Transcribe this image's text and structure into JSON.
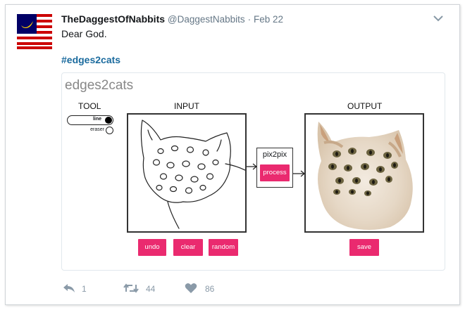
{
  "tweet": {
    "display_name": "TheDaggestOfNabbits",
    "handle": "@DaggestNabbits",
    "separator": "·",
    "date": "Feb 22",
    "text": "Dear God.",
    "hashtag": "#edges2cats",
    "avatar_icon": "flag-with-banana-icon"
  },
  "card": {
    "title": "edges2cats",
    "tool_label": "TOOL",
    "tool_options": [
      "line",
      "eraser"
    ],
    "selected_tool": "line",
    "input_label": "INPUT",
    "output_label": "OUTPUT",
    "model_label": "pix2pix",
    "process_label": "process",
    "undo_label": "undo",
    "clear_label": "clear",
    "random_label": "random",
    "save_label": "save",
    "accent_color": "#ea2a6f"
  },
  "actions": {
    "reply_count": "1",
    "retweet_count": "44",
    "like_count": "86"
  }
}
